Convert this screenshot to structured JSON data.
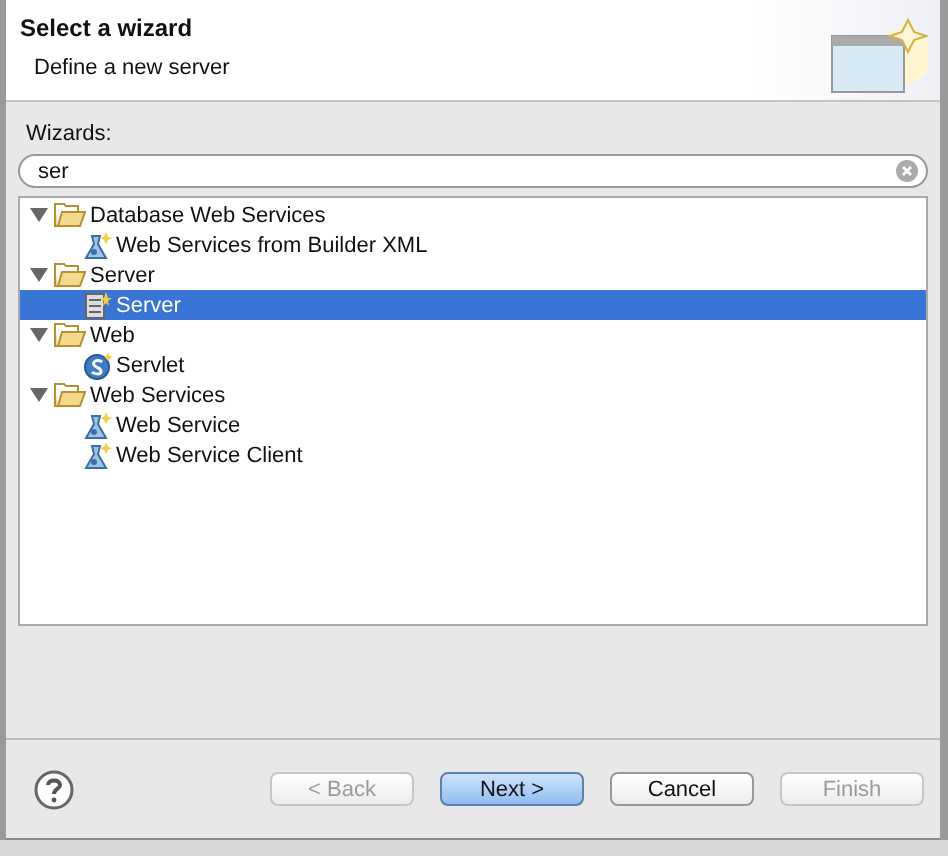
{
  "header": {
    "title": "Select a wizard",
    "description": "Define a new server"
  },
  "wizards": {
    "label": "Wizards:",
    "search": {
      "value": "ser"
    },
    "tree": [
      {
        "label": "Database Web Services",
        "expanded": true,
        "selected": false,
        "children": [
          {
            "label": "Web Services from Builder XML",
            "kind": "webservice",
            "selected": false
          }
        ]
      },
      {
        "label": "Server",
        "expanded": true,
        "selected": false,
        "children": [
          {
            "label": "Server",
            "kind": "server",
            "selected": true
          }
        ]
      },
      {
        "label": "Web",
        "expanded": true,
        "selected": false,
        "children": [
          {
            "label": "Servlet",
            "kind": "servlet",
            "selected": false
          }
        ]
      },
      {
        "label": "Web Services",
        "expanded": true,
        "selected": false,
        "children": [
          {
            "label": "Web Service",
            "kind": "webservice",
            "selected": false
          },
          {
            "label": "Web Service Client",
            "kind": "webservice",
            "selected": false
          }
        ]
      }
    ]
  },
  "buttons": [
    {
      "label": "< Back",
      "disabled": true,
      "default": false
    },
    {
      "label": "Next >",
      "disabled": false,
      "default": true
    },
    {
      "label": "Cancel",
      "disabled": false,
      "default": false
    },
    {
      "label": "Finish",
      "disabled": true,
      "default": false
    }
  ]
}
